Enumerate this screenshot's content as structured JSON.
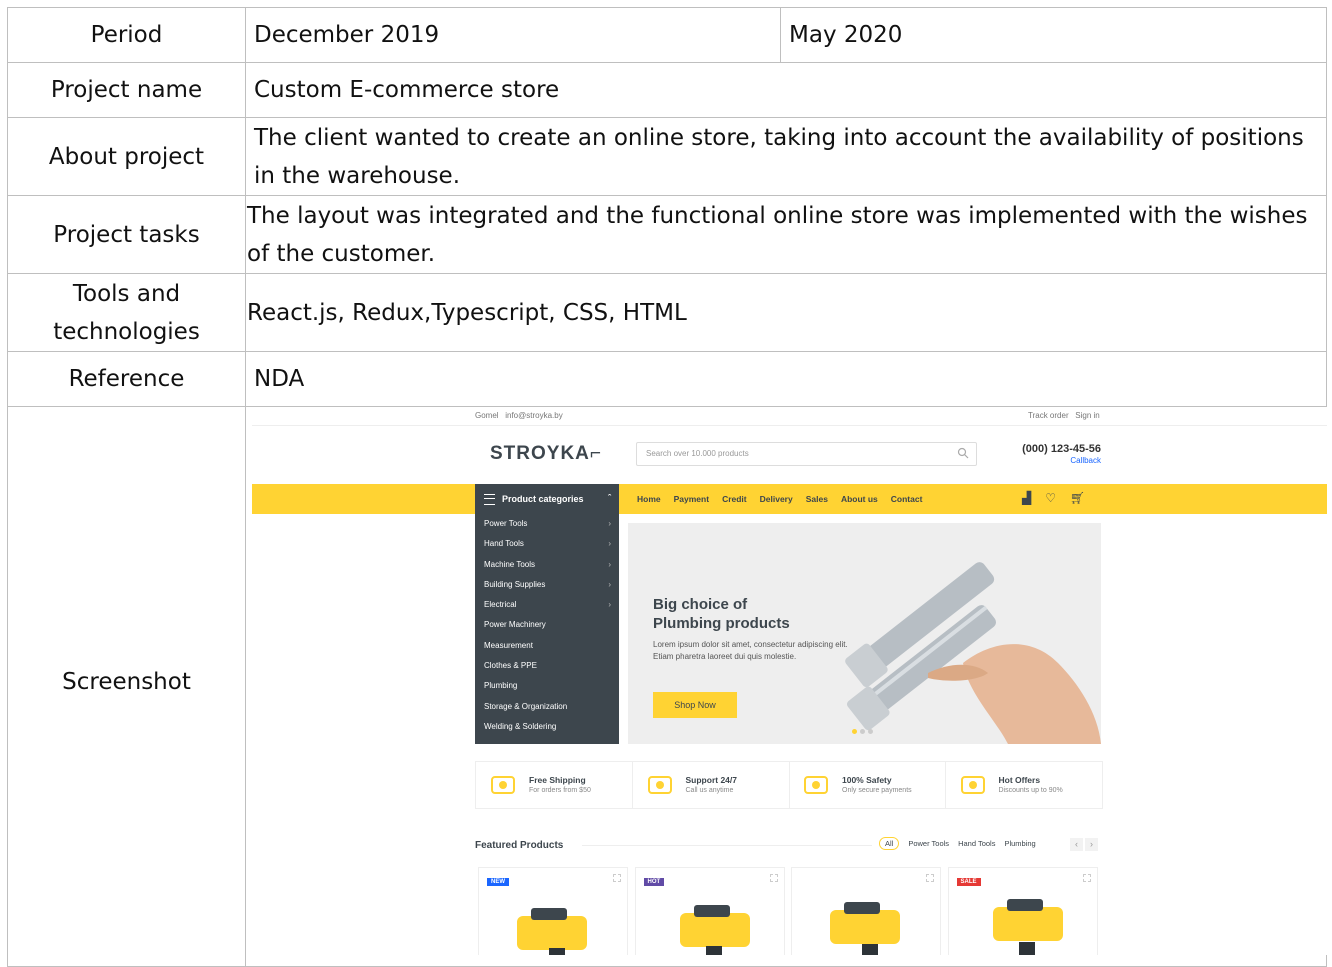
{
  "table": {
    "period_label": "Period",
    "period_start": "December 2019",
    "period_end": "May 2020",
    "project_name_label": "Project name",
    "project_name": "Custom E-commerce store",
    "about_label": "About project",
    "about_text": "The client wanted to create an online store, taking into account the availability of positions in the warehouse.",
    "tasks_label": "Project tasks",
    "tasks_text": "The layout was integrated and the functional online store was implemented with the wishes of the customer.",
    "tools_label": "Tools and technologies",
    "tools_text": "React.js, Redux,Typescript, CSS, HTML",
    "reference_label": "Reference",
    "reference_text": "NDA",
    "screenshot_label": "Screenshot"
  },
  "site": {
    "topbar_left": "Gomel   info@stroyka.by",
    "topbar_right": "Track order   Sign in",
    "logo": "STROYKA",
    "search_placeholder": "Search over 10.000 products",
    "phone": "(000) 123-45-56",
    "callback": "Callback",
    "categories_title": "Product categories",
    "nav": [
      "Home",
      "Payment",
      "Credit",
      "Delivery",
      "Sales",
      "About us",
      "Contact"
    ],
    "nav_icons": [
      "compare-icon",
      "wishlist-icon",
      "cart-icon"
    ],
    "categories": [
      {
        "label": "Power Tools",
        "sub": true
      },
      {
        "label": "Hand Tools",
        "sub": true
      },
      {
        "label": "Machine Tools",
        "sub": true
      },
      {
        "label": "Building Supplies",
        "sub": true
      },
      {
        "label": "Electrical",
        "sub": true
      },
      {
        "label": "Power Machinery",
        "sub": false
      },
      {
        "label": "Measurement",
        "sub": false
      },
      {
        "label": "Clothes & PPE",
        "sub": false
      },
      {
        "label": "Plumbing",
        "sub": false
      },
      {
        "label": "Storage & Organization",
        "sub": false
      },
      {
        "label": "Welding & Soldering",
        "sub": false
      }
    ],
    "hero_title_1": "Big choice of",
    "hero_title_2": "Plumbing products",
    "hero_text_1": "Lorem ipsum dolor sit amet, consectetur adipiscing elit.",
    "hero_text_2": "Etiam pharetra laoreet dui quis molestie.",
    "hero_button": "Shop Now",
    "features": [
      {
        "title": "Free Shipping",
        "sub": "For orders from $50"
      },
      {
        "title": "Support 24/7",
        "sub": "Call us anytime"
      },
      {
        "title": "100% Safety",
        "sub": "Only secure payments"
      },
      {
        "title": "Hot Offers",
        "sub": "Discounts up to 90%"
      }
    ],
    "featured_title": "Featured Products",
    "filters": [
      "All",
      "Power Tools",
      "Hand Tools",
      "Plumbing"
    ],
    "badges": [
      "NEW",
      "HOT",
      "",
      "SALE"
    ],
    "colors": {
      "accent": "#ffd333",
      "dark": "#3d464d",
      "badge_new": "#1a66ff",
      "badge_hot": "#614ba6",
      "badge_sale": "#e53935"
    }
  }
}
